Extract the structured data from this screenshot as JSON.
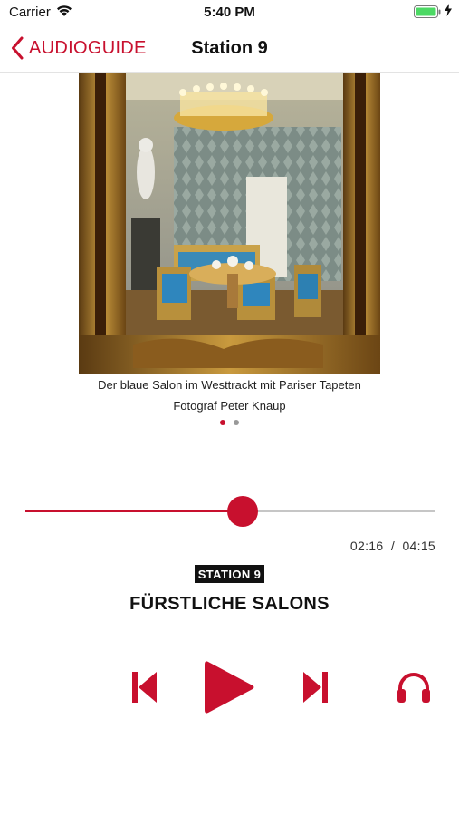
{
  "status_bar": {
    "carrier": "Carrier",
    "time": "5:40 PM"
  },
  "nav": {
    "back_label": "AUDIOGUIDE",
    "title": "Station 9"
  },
  "gallery": {
    "caption_line1": "Der blaue Salon im Westtrackt mit Pariser Tapeten",
    "caption_line2": "Fotograf Peter Knaup",
    "page_count": 2,
    "active_page": 1
  },
  "player": {
    "progress": 0.53,
    "elapsed": "02:16",
    "separator": "/",
    "duration": "04:15",
    "station_badge": "STATION 9",
    "track_title": "FÜRSTLICHE SALONS"
  },
  "colors": {
    "accent": "#c8102e",
    "text": "#111111",
    "track": "#c6c6c6"
  },
  "icons": {
    "back": "chevron-left-icon",
    "previous": "skip-previous-icon",
    "play": "play-icon",
    "next": "skip-next-icon",
    "headphones": "headphones-icon"
  }
}
